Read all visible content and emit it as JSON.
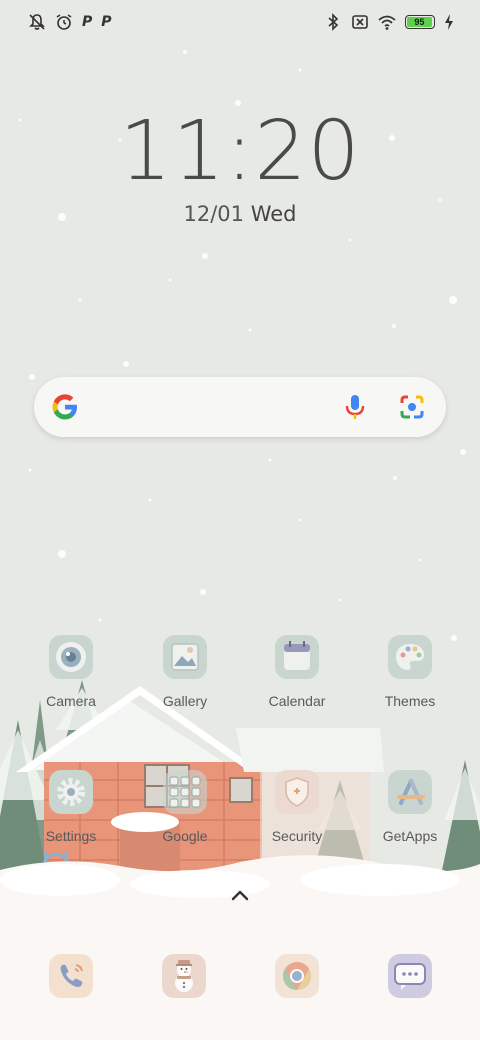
{
  "status_bar": {
    "left_icons": [
      "notifications-off-icon",
      "alarm-icon",
      "p-icon",
      "p-icon"
    ],
    "p_glyph": "P",
    "right_icons": [
      "bluetooth-icon",
      "no-sim-icon",
      "wifi-icon",
      "battery-icon",
      "charging-icon"
    ],
    "battery_level": "95"
  },
  "clock": {
    "time": "11:20",
    "date": "12/01",
    "weekday": "Wed"
  },
  "search_bar": {
    "icons": [
      "google-logo-icon",
      "microphone-icon",
      "lens-icon"
    ]
  },
  "apps": [
    {
      "label": "Camera",
      "icon": "camera-icon"
    },
    {
      "label": "Gallery",
      "icon": "gallery-icon"
    },
    {
      "label": "Calendar",
      "icon": "calendar-icon"
    },
    {
      "label": "Themes",
      "icon": "themes-icon"
    },
    {
      "label": "Settings",
      "icon": "settings-icon"
    },
    {
      "label": "Google",
      "icon": "google-folder-icon"
    },
    {
      "label": "Security",
      "icon": "security-icon"
    },
    {
      "label": "GetApps",
      "icon": "getapps-icon"
    }
  ],
  "dock": [
    {
      "icon": "phone-icon"
    },
    {
      "icon": "snowman-icon"
    },
    {
      "icon": "chrome-icon"
    },
    {
      "icon": "messages-icon"
    }
  ],
  "app_drawer_hint": {
    "icon": "chevron-up-icon"
  },
  "colors": {
    "background": "#e6e9e4",
    "battery": "#5cd24a",
    "house": "#e8957a",
    "icon_tile": "#cdd6cf"
  }
}
